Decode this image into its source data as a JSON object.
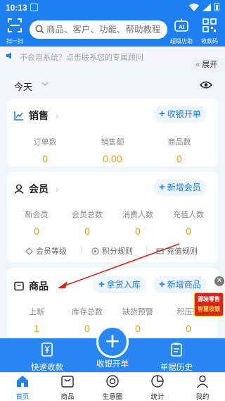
{
  "status_bar": {
    "time": "10:13"
  },
  "header": {
    "scan_label": "扫一扫",
    "search_placeholder": "商品、客户、功能、帮助教程",
    "ai_label": "超级店助",
    "ai_badge": "AI",
    "code_label": "收款码"
  },
  "notice": {
    "text": "不会用系统？点击联系您的专属顾问",
    "expand_label": "展开"
  },
  "date_filter": {
    "label": "今天"
  },
  "sales": {
    "title": "销售",
    "action": "收银开单",
    "stats": [
      {
        "label": "订单数",
        "value": "0"
      },
      {
        "label": "销售额",
        "value": "0.00"
      },
      {
        "label": "商品数",
        "value": "0"
      }
    ]
  },
  "members": {
    "title": "会员",
    "action": "新增会员",
    "stats": [
      {
        "label": "新会员",
        "value": "0"
      },
      {
        "label": "会员总数",
        "value": "0"
      },
      {
        "label": "消费人数",
        "value": "0"
      },
      {
        "label": "充值人数",
        "value": "0"
      }
    ],
    "links": [
      "会员等级",
      "积分规则",
      "充值规则"
    ]
  },
  "goods": {
    "title": "商品",
    "action1": "拿货入库",
    "action2": "新增商品",
    "stats": [
      {
        "label": "上新",
        "value": "1"
      },
      {
        "label": "库存总数",
        "value": "0"
      },
      {
        "label": "缺货预警",
        "value": "0"
      },
      {
        "label": "积压预",
        "value": "0"
      }
    ]
  },
  "promo": {
    "line1": "源装零售",
    "line2": "智慧收银"
  },
  "action_bar": {
    "left": "快速收款",
    "center": "收银开单",
    "right": "单据历史"
  },
  "bottom_nav": [
    {
      "label": "首页",
      "active": true
    },
    {
      "label": "商品"
    },
    {
      "label": "生意圈"
    },
    {
      "label": "统计"
    },
    {
      "label": "我的"
    }
  ],
  "colors": {
    "primary": "#1e7ff0",
    "value": "#f29b18",
    "annotation": "#d8261c"
  }
}
